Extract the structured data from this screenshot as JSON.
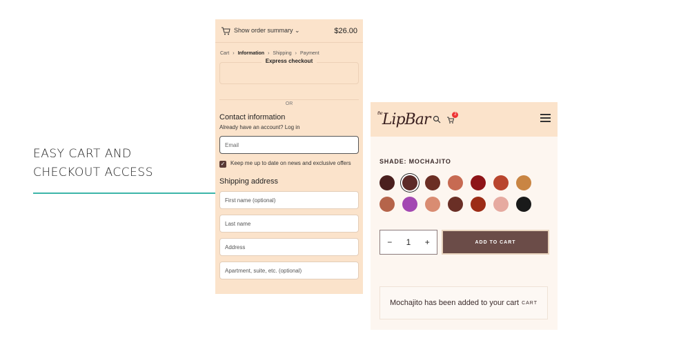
{
  "caption": {
    "line1": "EASY CART AND",
    "line2": "CHECKOUT ACCESS",
    "accent_color": "#3bb5a8"
  },
  "checkout": {
    "summary_label": "Show order summary ⌄",
    "total": "$26.00",
    "breadcrumbs": [
      "Cart",
      "Information",
      "Shipping",
      "Payment"
    ],
    "breadcrumb_sep": "›",
    "express_label": "Express checkout",
    "or_label": "OR",
    "contact_title": "Contact information",
    "account_prompt": "Already have an account? Log in",
    "email_placeholder": "Email",
    "newsletter_label": "Keep me up to date on news and exclusive offers",
    "newsletter_checked": true,
    "shipping_title": "Shipping address",
    "fields": {
      "first_name": "First name (optional)",
      "last_name": "Last name",
      "address": "Address",
      "apartment": "Apartment, suite, etc. (optional)"
    },
    "bg_color": "#fbe3cb"
  },
  "product": {
    "logo": "LipBar",
    "logo_prefix": "the",
    "cart_count": "2",
    "shade_label": "SHADE: MOCHAJITO",
    "swatch_colors": [
      "#4a1f1e",
      "#5c2a27",
      "#6b2e24",
      "#c76a52",
      "#8e1418",
      "#b9452e",
      "#c98543",
      "#b5644a",
      "#a348b2",
      "#d98c72",
      "#6a2f26",
      "#9c2c16",
      "#e6aaa0",
      "#1a1a1a"
    ],
    "selected_swatch": 1,
    "quantity": "1",
    "minus": "−",
    "plus": "+",
    "add_to_cart": "ADD TO CART",
    "toast_message": "Mochajito has been added to your cart",
    "toast_link": "CART"
  }
}
